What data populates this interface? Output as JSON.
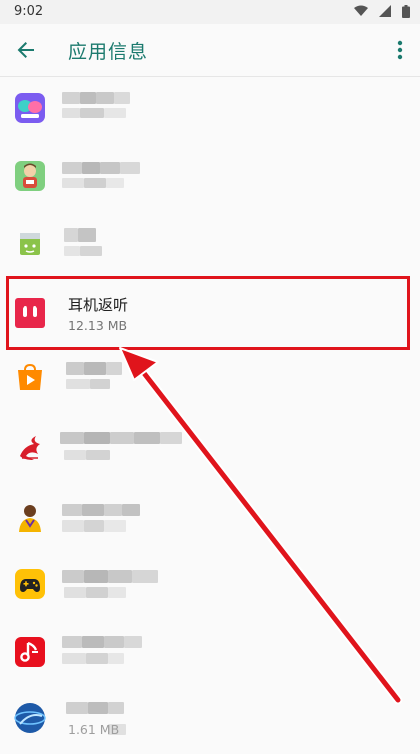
{
  "status_bar": {
    "time": "9:02",
    "icons": [
      "wifi-icon",
      "signal-icon",
      "battery-icon"
    ]
  },
  "app_bar": {
    "title": "应用信息",
    "back_icon": "arrow-left-icon",
    "menu_icon": "more-vert-icon"
  },
  "apps": [
    {
      "name": "",
      "size": "",
      "icon": "chat-bubbles-app-icon",
      "blurred": true
    },
    {
      "name": "",
      "size": "",
      "icon": "character-app-icon",
      "blurred": true
    },
    {
      "name": "",
      "size": "",
      "icon": "android-box-app-icon",
      "blurred": true
    },
    {
      "name": "耳机返听",
      "size": "12.13 MB",
      "icon": "earphone-app-icon",
      "blurred": false,
      "highlighted": true
    },
    {
      "name": "",
      "size": "",
      "icon": "shopping-bag-app-icon",
      "blurred": true
    },
    {
      "name": "",
      "size": "",
      "icon": "dragon-app-icon",
      "blurred": true
    },
    {
      "name": "",
      "size": "",
      "icon": "basketball-player-app-icon",
      "blurred": true
    },
    {
      "name": "",
      "size": "",
      "icon": "gamepad-app-icon",
      "blurred": true
    },
    {
      "name": "",
      "size": "",
      "icon": "music-note-app-icon",
      "blurred": true
    },
    {
      "name": "",
      "size": "1.61 MB",
      "icon": "globe-app-icon",
      "blurred": true
    }
  ],
  "colors": {
    "accent": "#1b7a6e",
    "highlight": "#e0141c",
    "background": "#fafafa"
  }
}
